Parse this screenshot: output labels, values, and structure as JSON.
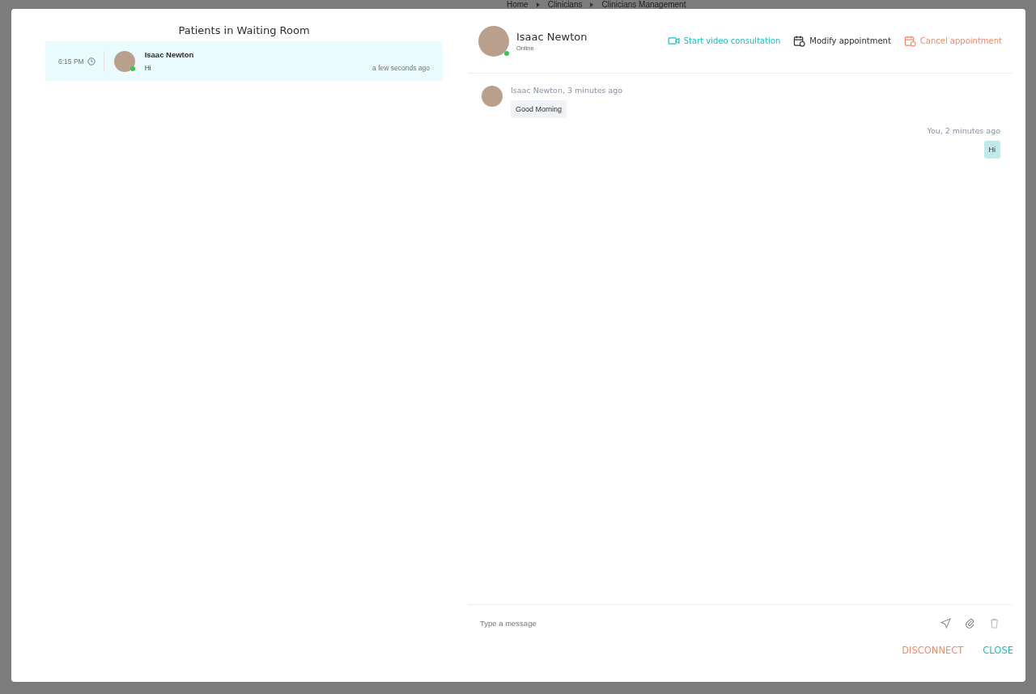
{
  "breadcrumb": [
    "Home",
    "Clinicians",
    "Clinicians Management"
  ],
  "waiting_room": {
    "title": "Patients in Waiting Room",
    "patients": [
      {
        "time": "6:15 PM",
        "name": "Isaac Newton",
        "last_message": "Hi",
        "ago": "a few seconds ago",
        "online": true,
        "selected": true
      }
    ]
  },
  "chat": {
    "name": "Isaac Newton",
    "status": "Online",
    "online": true,
    "actions": [
      {
        "kind": "video",
        "label": "Start video consultation"
      },
      {
        "kind": "modify",
        "label": "Modify appointment"
      },
      {
        "kind": "cancel",
        "label": "Cancel appointment"
      }
    ],
    "messages": [
      {
        "kind": "incoming",
        "meta": "Isaac Newton, 3 minutes ago",
        "text": "Good Morning"
      },
      {
        "kind": "outgoing",
        "meta": "You, 2 minutes ago",
        "text": "Hi"
      }
    ],
    "composer": {
      "placeholder": "Type a message"
    }
  },
  "footer_buttons": [
    {
      "kind": "danger",
      "label": "DISCONNECT"
    },
    {
      "kind": "primary",
      "label": "CLOSE"
    }
  ]
}
